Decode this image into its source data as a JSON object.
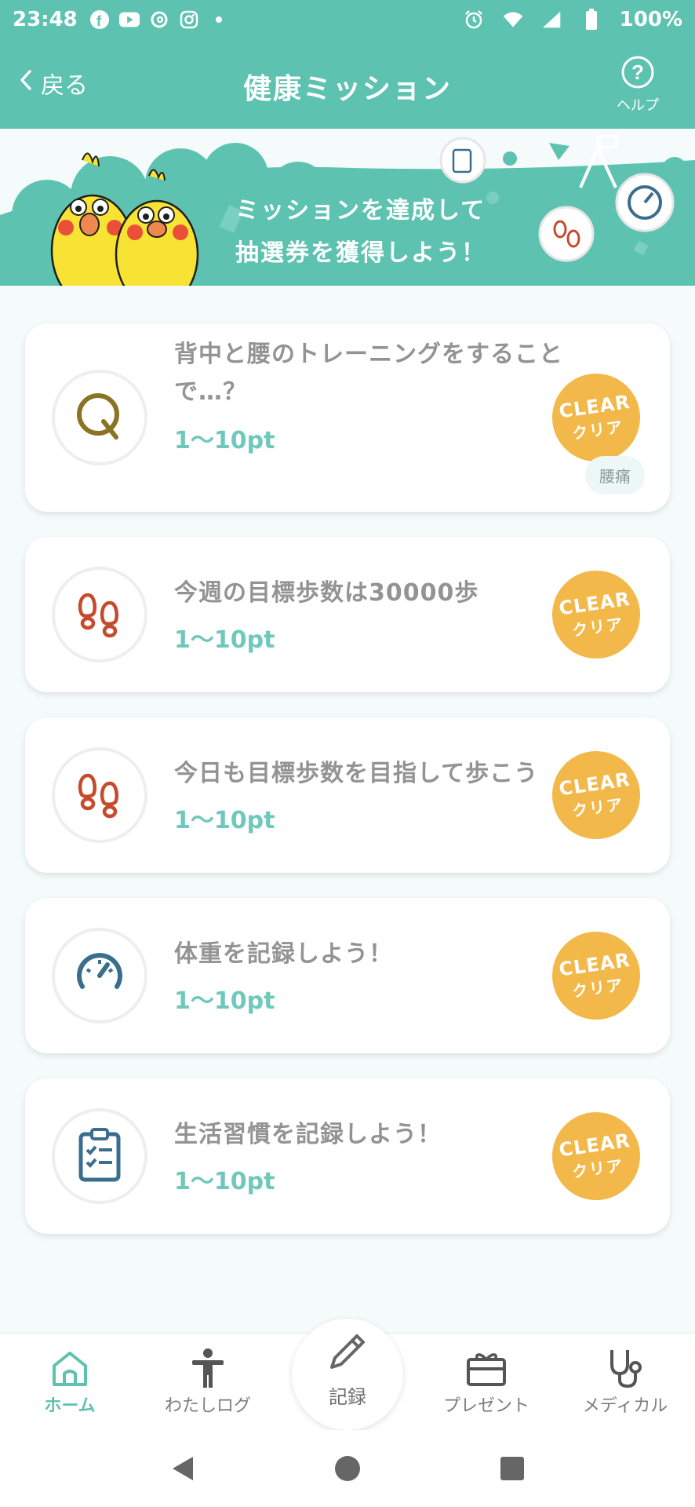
{
  "status_bar": {
    "time": "23:48",
    "battery": "100%",
    "icons": [
      "facebook-icon",
      "youtube-icon",
      "threads-icon",
      "instagram-icon",
      "dot-icon",
      "alarm-icon",
      "wifi-icon",
      "signal-icon",
      "battery-icon"
    ]
  },
  "header": {
    "back_label": "戻る",
    "title": "健康ミッション",
    "help_label": "ヘルプ"
  },
  "banner": {
    "line1": "ミッションを達成して",
    "line2": "抽選券を獲得しよう！"
  },
  "missions": [
    {
      "icon": "quiz-q-icon",
      "title": "背中と腰のトレーニングをすることで…？",
      "points": "1〜10pt",
      "clear_en": "CLEAR",
      "clear_jp": "クリア",
      "tag": "腰痛"
    },
    {
      "icon": "footprints-icon",
      "title": "今週の目標歩数は30000歩",
      "points": "1〜10pt",
      "clear_en": "CLEAR",
      "clear_jp": "クリア"
    },
    {
      "icon": "footprints-icon",
      "title": "今日も目標歩数を目指して歩こう",
      "points": "1〜10pt",
      "clear_en": "CLEAR",
      "clear_jp": "クリア"
    },
    {
      "icon": "gauge-icon",
      "title": "体重を記録しよう！",
      "points": "1〜10pt",
      "clear_en": "CLEAR",
      "clear_jp": "クリア"
    },
    {
      "icon": "clipboard-checklist-icon",
      "title": "生活習慣を記録しよう！",
      "points": "1〜10pt",
      "clear_en": "CLEAR",
      "clear_jp": "クリア"
    }
  ],
  "bottom_nav": {
    "home": "ホーム",
    "log": "わたしログ",
    "record": "記録",
    "present": "プレゼント",
    "medical": "メディカル"
  },
  "colors": {
    "brand_teal": "#5ec2b0",
    "points_teal": "#6fc8bb",
    "clear_orange": "#f3b84a"
  }
}
